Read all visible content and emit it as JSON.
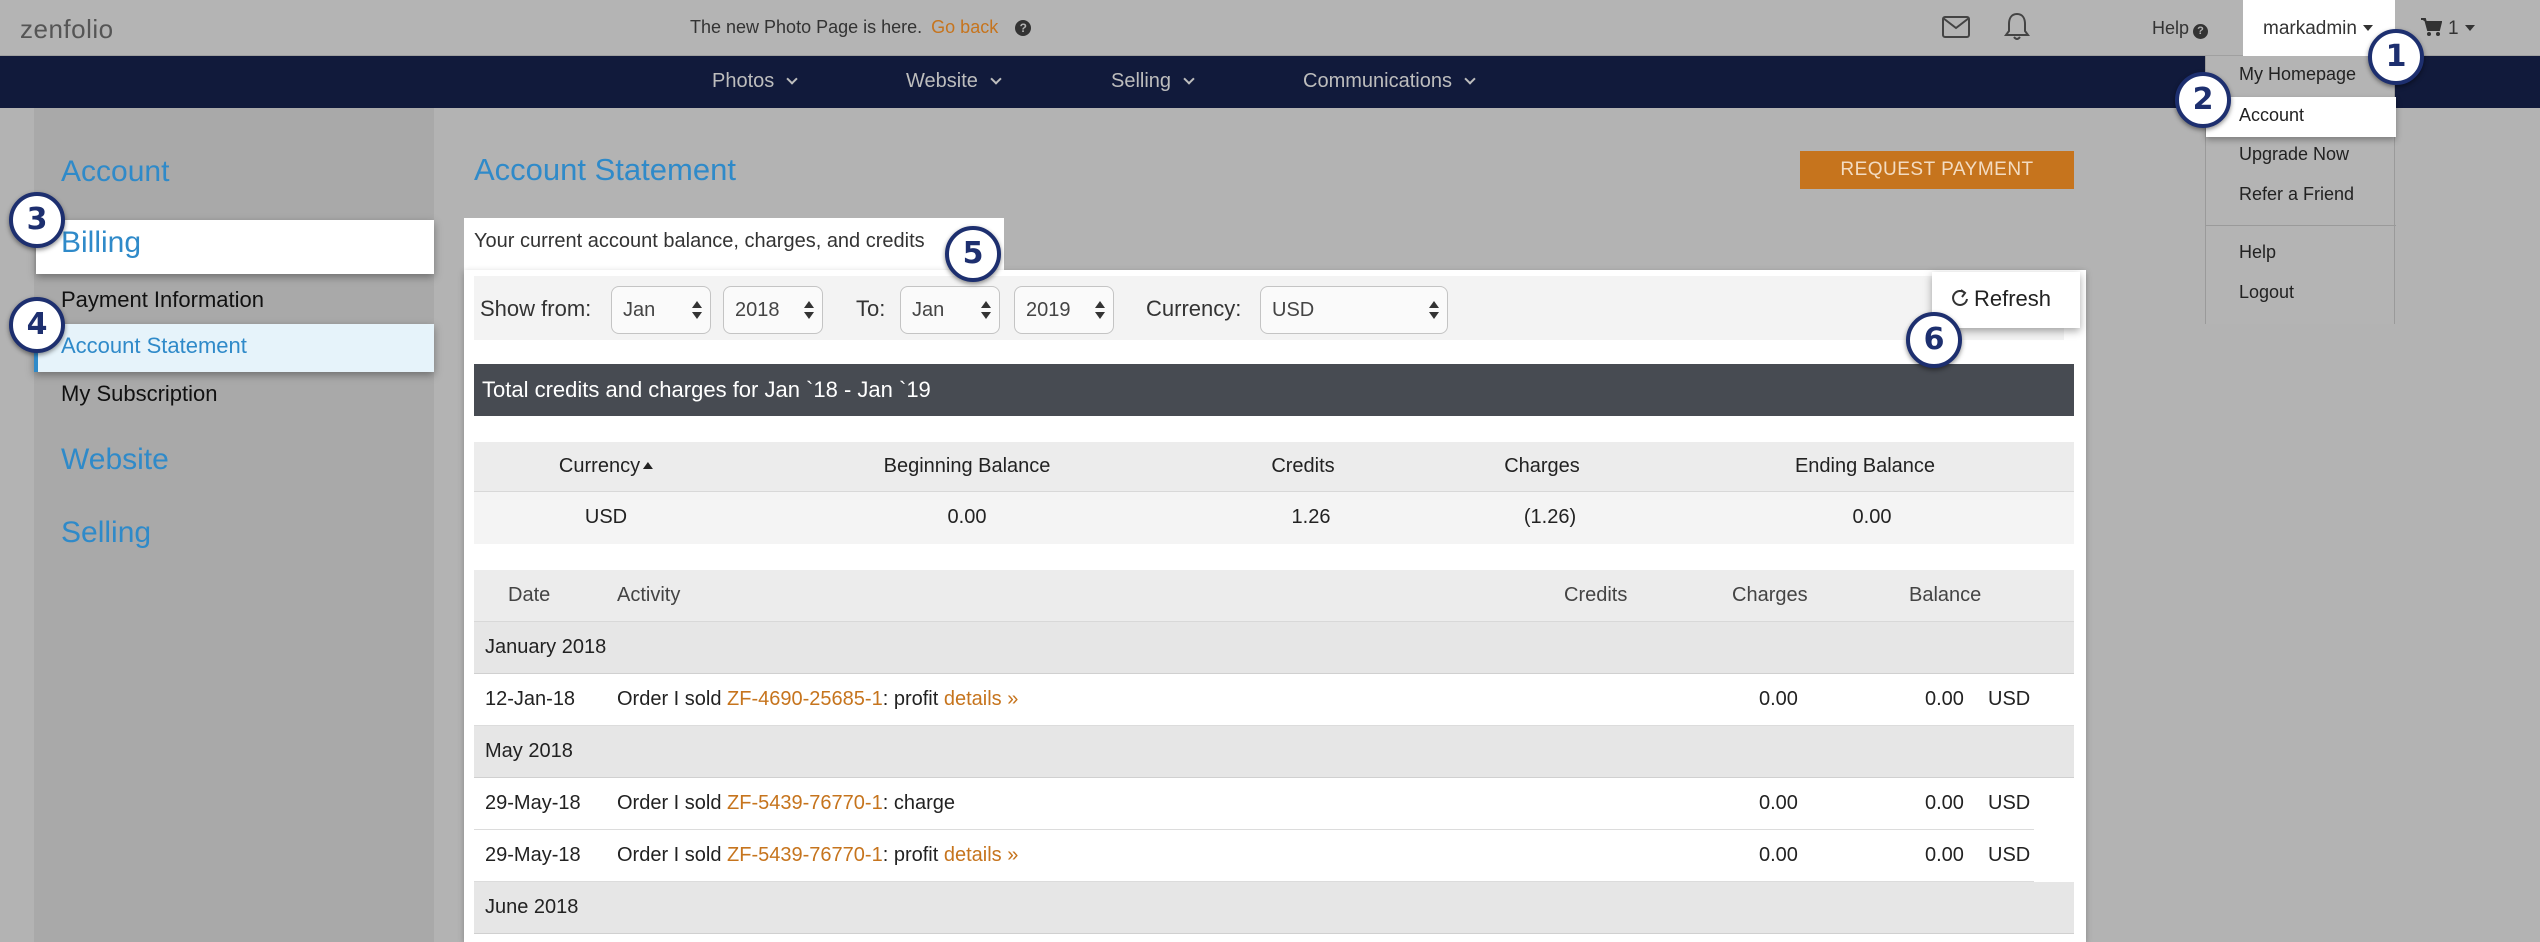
{
  "topbar": {
    "logo": "zenfolio",
    "announcement": "The new Photo Page is here.",
    "go_back": "Go back",
    "help": "Help",
    "username": "markadmin",
    "cart_count": "1"
  },
  "nav": {
    "items": [
      "Photos",
      "Website",
      "Selling",
      "Communications"
    ]
  },
  "user_menu": {
    "items": [
      "My Homepage",
      "Account",
      "Upgrade Now",
      "Refer a Friend",
      "Help",
      "Logout"
    ],
    "selected": "Account"
  },
  "sidebar": {
    "account": "Account",
    "billing": "Billing",
    "billing_items": [
      "Payment Information",
      "Account Statement",
      "My Subscription"
    ],
    "active_item": "Account Statement",
    "website": "Website",
    "selling": "Selling"
  },
  "main": {
    "title": "Account Statement",
    "request_payment": "REQUEST PAYMENT",
    "intro": "Your current account balance, charges, and credits"
  },
  "filters": {
    "show_from_label": "Show from:",
    "from_month": "Jan",
    "from_year": "2018",
    "to_label": "To:",
    "to_month": "Jan",
    "to_year": "2019",
    "currency_label": "Currency:",
    "currency": "USD",
    "refresh": "Refresh"
  },
  "summary": {
    "header": "Total credits and charges for Jan `18 - Jan `19",
    "columns": [
      "Currency",
      "Beginning Balance",
      "Credits",
      "Charges",
      "Ending Balance"
    ],
    "row": [
      "USD",
      "0.00",
      "1.26",
      "(1.26)",
      "0.00"
    ]
  },
  "activity": {
    "columns": [
      "Date",
      "Activity",
      "Credits",
      "Charges",
      "Balance"
    ],
    "groups": [
      {
        "month": "January 2018",
        "rows": [
          {
            "date": "12-Jan-18",
            "prefix": "Order I sold ",
            "order": "ZF-4690-25685-1",
            "suffix": ": profit ",
            "details": "details »",
            "charges": "0.00",
            "balance": "0.00",
            "currency": "USD"
          }
        ]
      },
      {
        "month": "May 2018",
        "rows": [
          {
            "date": "29-May-18",
            "prefix": "Order I sold ",
            "order": "ZF-5439-76770-1",
            "suffix": ": charge",
            "details": "",
            "charges": "0.00",
            "balance": "0.00",
            "currency": "USD"
          },
          {
            "date": "29-May-18",
            "prefix": "Order I sold ",
            "order": "ZF-5439-76770-1",
            "suffix": ": profit ",
            "details": "details »",
            "charges": "0.00",
            "balance": "0.00",
            "currency": "USD"
          }
        ]
      },
      {
        "month": "June 2018",
        "rows": []
      }
    ]
  },
  "callouts": [
    "1",
    "2",
    "3",
    "4",
    "5",
    "6"
  ],
  "colors": {
    "accent_blue": "#2f8ac9",
    "orange": "#c6741d",
    "nav_bg": "#111a3b",
    "callout": "#1d2f6f"
  }
}
